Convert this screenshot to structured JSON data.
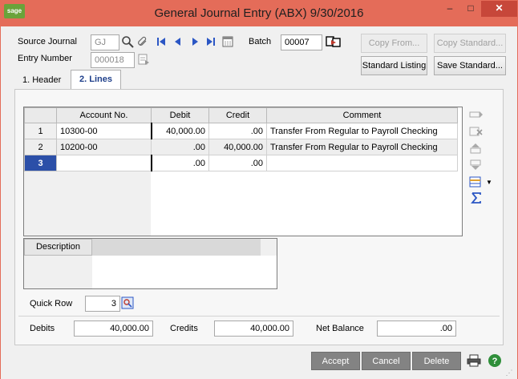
{
  "window": {
    "title": "General Journal Entry (ABX) 9/30/2016",
    "logo": "sage",
    "min_glyph": "–",
    "max_glyph": "□",
    "close_glyph": "✕"
  },
  "header": {
    "source_journal_label": "Source Journal",
    "source_journal_value": "GJ",
    "entry_number_label": "Entry Number",
    "entry_number_value": "000018",
    "batch_label": "Batch",
    "batch_value": "00007",
    "copy_from_label": "Copy From...",
    "copy_standard_label": "Copy Standard...",
    "standard_listing_label": "Standard Listing",
    "save_standard_label": "Save Standard..."
  },
  "tabs": [
    {
      "label": "1. Header"
    },
    {
      "label": "2. Lines"
    }
  ],
  "grid": {
    "columns": [
      "Account No.",
      "Debit",
      "Credit",
      "Comment"
    ],
    "rows": [
      {
        "num": "1",
        "account": "10300-00",
        "debit": "40,000.00",
        "credit": ".00",
        "comment": "Transfer From Regular to Payroll Checking"
      },
      {
        "num": "2",
        "account": "10200-00",
        "debit": ".00",
        "credit": "40,000.00",
        "comment": "Transfer From Regular to Payroll Checking"
      },
      {
        "num": "3",
        "account": "",
        "debit": ".00",
        "credit": ".00",
        "comment": ""
      }
    ]
  },
  "description": {
    "label": "Description",
    "value": ""
  },
  "quick_row": {
    "label": "Quick Row",
    "value": "3"
  },
  "totals": {
    "debits_label": "Debits",
    "debits_value": "40,000.00",
    "credits_label": "Credits",
    "credits_value": "40,000.00",
    "net_balance_label": "Net Balance",
    "net_balance_value": ".00"
  },
  "footer": {
    "accept_label": "Accept",
    "cancel_label": "Cancel",
    "delete_label": "Delete"
  },
  "icons": {
    "lookup": "🔍",
    "first": "⏮",
    "prev": "◀",
    "next": "▶",
    "last": "⏭",
    "calendar": "▦",
    "help": "?"
  },
  "colors": {
    "titlebar": "#e46c59",
    "close": "#c7473a",
    "selected_row": "#2b4fa8",
    "footer_button": "#838383"
  }
}
